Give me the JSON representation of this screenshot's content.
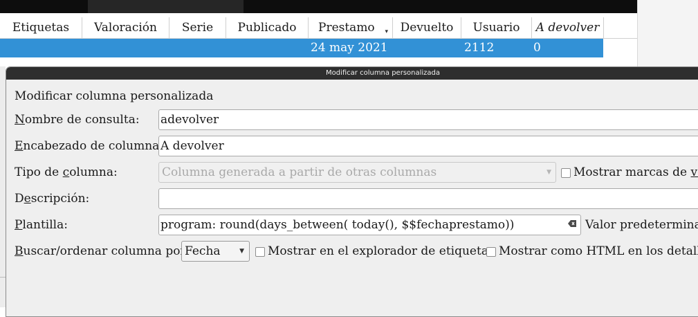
{
  "table": {
    "headers": [
      {
        "label": "Etiquetas"
      },
      {
        "label": "Valoración"
      },
      {
        "label": "Serie"
      },
      {
        "label": "Publicado"
      },
      {
        "label": "Prestamo"
      },
      {
        "label": "Devuelto"
      },
      {
        "label": "Usuario"
      },
      {
        "label": "A devolver"
      }
    ],
    "sort_indicator": "▾",
    "row": {
      "prestamo": "24 may 2021",
      "usuario": "2112",
      "a_devolver": "0"
    }
  },
  "dialog": {
    "title": "Modificar columna personalizada",
    "heading": "Modificar columna personalizada",
    "lookup": {
      "label_u": "N",
      "label_rest": "ombre de consulta:",
      "value": "adevolver"
    },
    "header_name": {
      "label_u": "E",
      "label_rest": "ncabezado de columna:",
      "value": "A devolver"
    },
    "type": {
      "label_pre": "Tipo de ",
      "label_u": "c",
      "label_rest": "olumna:",
      "value": "Columna generada a partir de otras columnas"
    },
    "show_checkmarks": {
      "label_pre": "Mostrar marcas de ",
      "label_u": "ver",
      "label_rest": ""
    },
    "description": {
      "label_pre": "D",
      "label_u": "e",
      "label_rest": "scripción:",
      "value": ""
    },
    "template": {
      "label_u": "P",
      "label_rest": "lantilla:",
      "value": "program: round(days_between( today(), $$fechaprestamo))"
    },
    "default_value_label": "Valor predeterminad",
    "sort_by": {
      "label_u": "B",
      "label_rest": "uscar/ordenar columna por",
      "value": "Fecha"
    },
    "show_in_tag_browser": "Mostrar en el explorador de etiquetas",
    "show_as_html": "Mostrar como HTML en los detalles"
  }
}
